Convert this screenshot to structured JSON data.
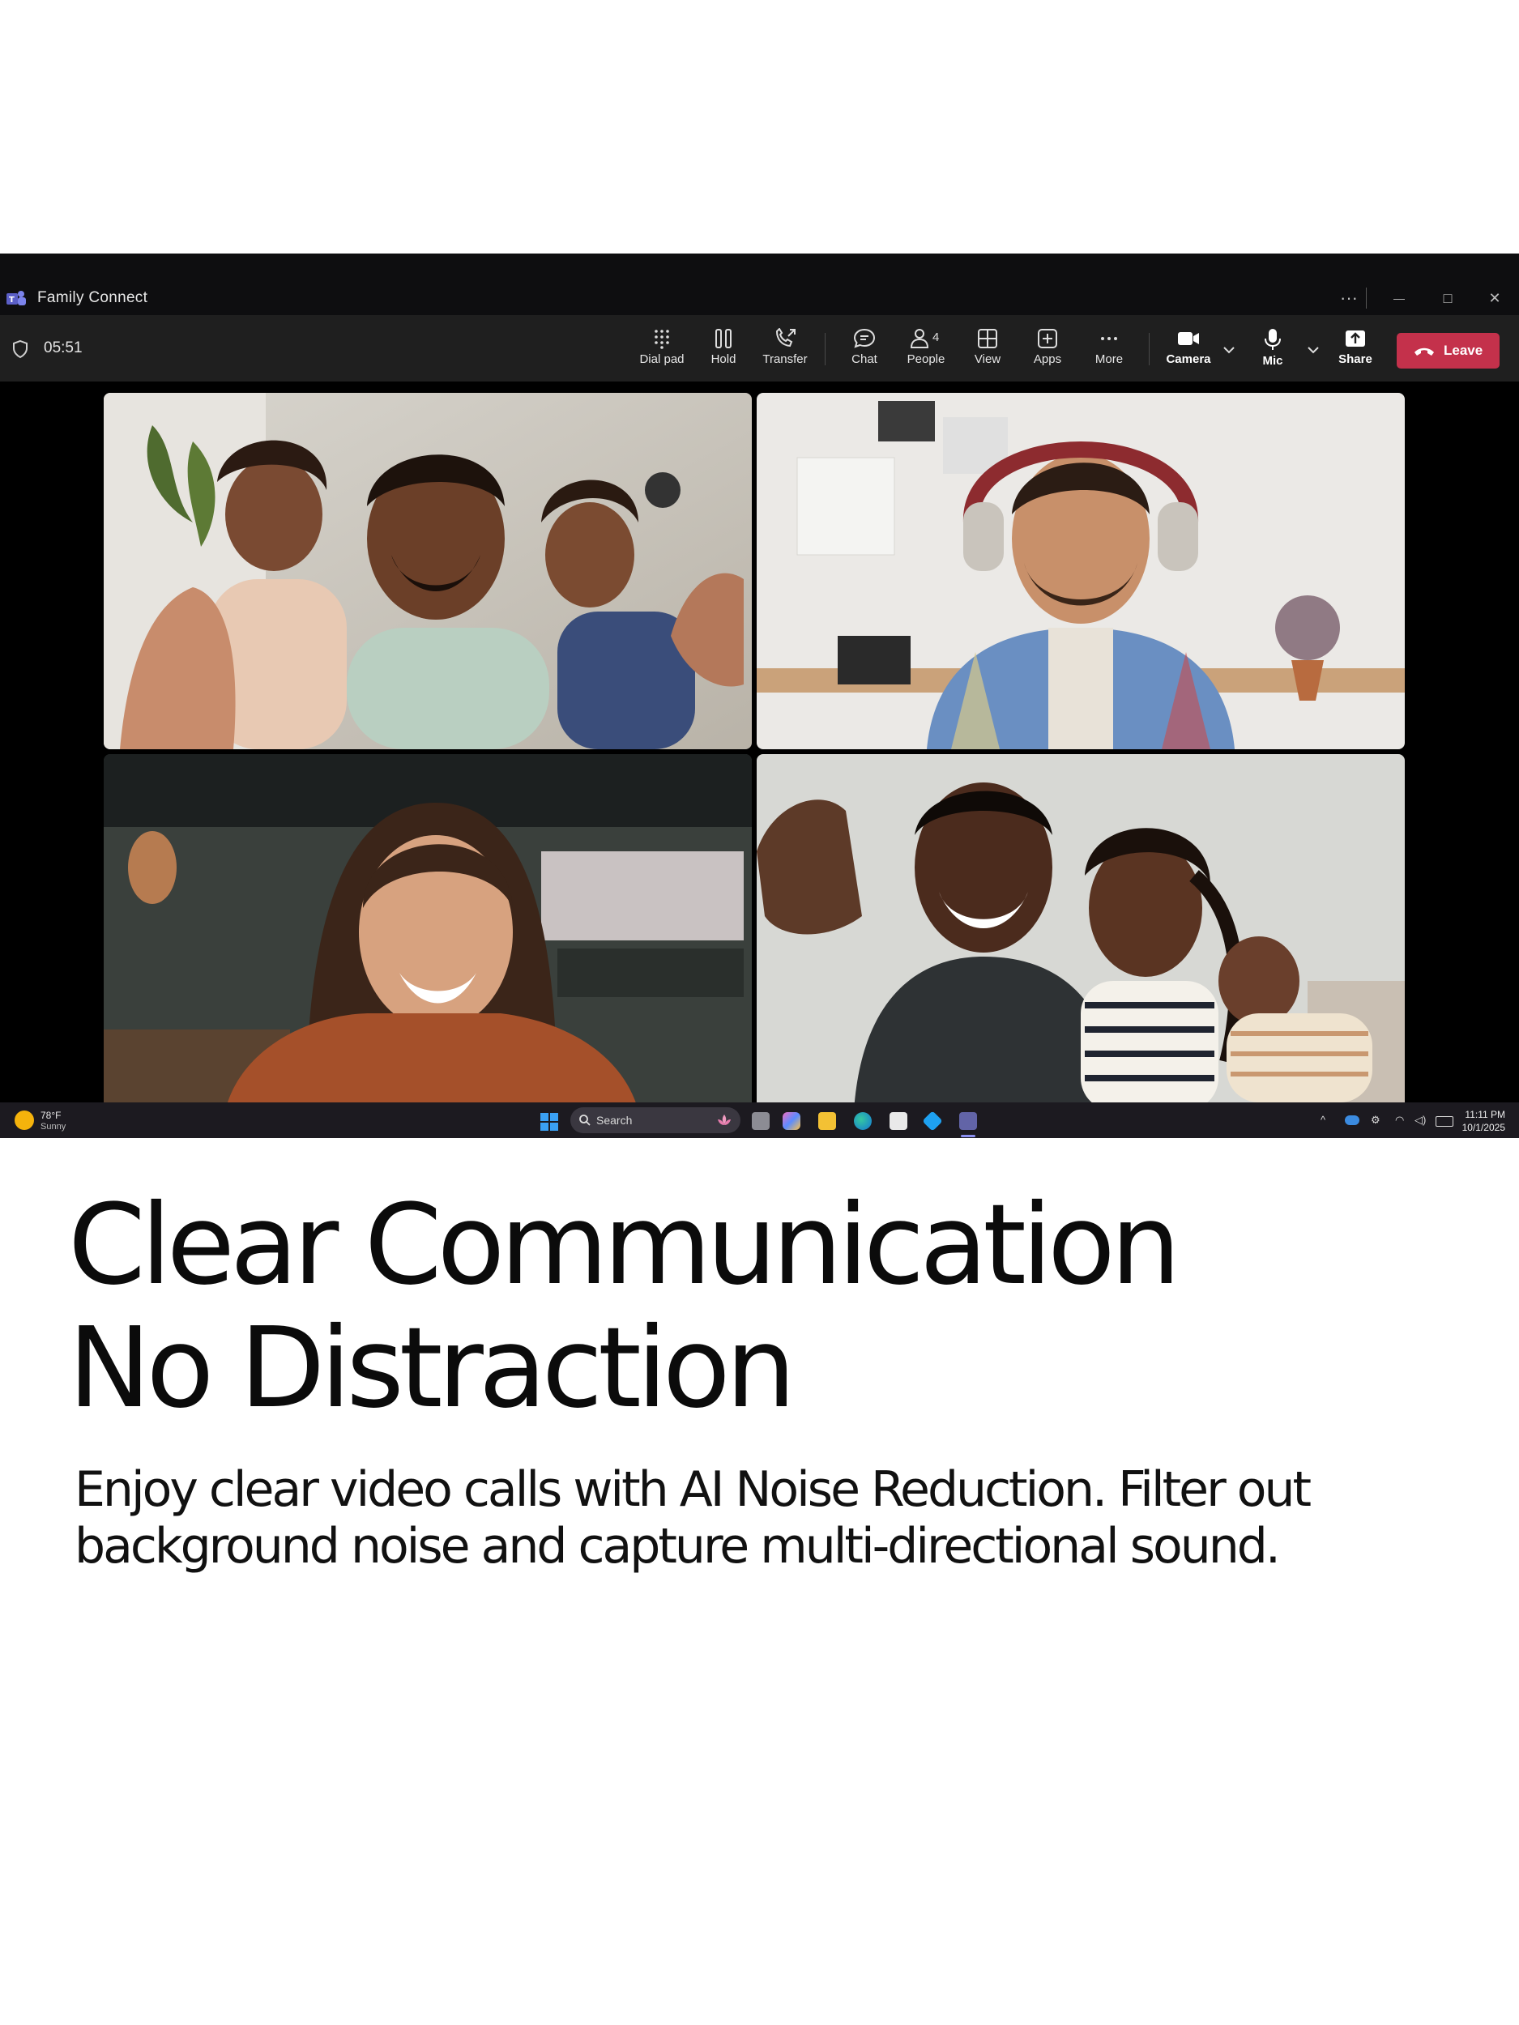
{
  "window": {
    "title": "Family Connect"
  },
  "window_controls": {
    "more": "···",
    "minimize": "—",
    "maximize": "□",
    "close": "✕"
  },
  "call": {
    "timer": "05:51",
    "people_count": "4"
  },
  "toolbar": {
    "dial_pad": "Dial pad",
    "hold": "Hold",
    "transfer": "Transfer",
    "chat": "Chat",
    "people": "People",
    "view": "View",
    "apps": "Apps",
    "more": "More",
    "camera": "Camera",
    "mic": "Mic",
    "share": "Share",
    "leave": "Leave"
  },
  "participants": [
    {
      "tile": "family-with-two-children"
    },
    {
      "tile": "man-with-headphones"
    },
    {
      "tile": "smiling-woman"
    },
    {
      "tile": "couple-with-baby"
    }
  ],
  "taskbar": {
    "weather": {
      "temp": "78°F",
      "condition": "Sunny"
    },
    "search_placeholder": "Search",
    "clock": {
      "time": "11:11 PM",
      "date": "10/1/2025"
    }
  },
  "marketing": {
    "headline": [
      "Clear Communication",
      "No Distraction"
    ],
    "body": [
      "Enjoy clear video calls with AI Noise Reduction. Filter out",
      "background noise and capture multi-directional sound."
    ]
  },
  "colors": {
    "leave_button": "#c4314b",
    "toolbar_bg": "#1f1f1f",
    "titlebar_bg": "#0e0e10",
    "taskbar_bg": "#1c1a20"
  }
}
